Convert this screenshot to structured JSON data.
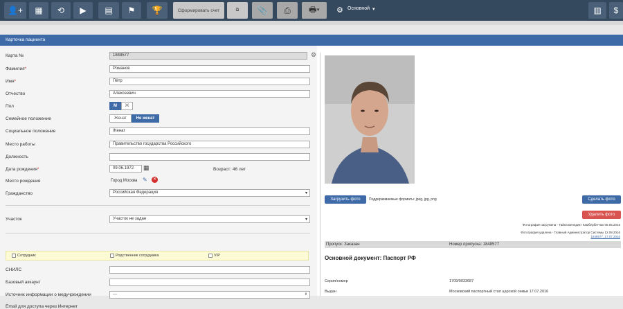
{
  "toolbar": {
    "form_invoice_label": "Сформировать счет",
    "profile_label": "Основной",
    "dollar_symbol": "$"
  },
  "panel": {
    "title": "Карточка пациента"
  },
  "form": {
    "card_label": "Карта №",
    "card_value": "1848577",
    "surname_label": "Фамилия",
    "surname_value": "Романов",
    "name_label": "Имя",
    "name_value": "Пётр",
    "patronymic_label": "Отчество",
    "patronymic_value": "Алексеевич",
    "sex_label": "Пол",
    "sex_m": "М",
    "sex_f": "Ж",
    "marital_label": "Семейное положение",
    "marital_married": "Женат",
    "marital_single": "Не женат",
    "social_label": "Социальное положение",
    "social_value": "Женат",
    "work_label": "Место работы",
    "work_value": "Правительство государства Российского",
    "position_label": "Должность",
    "position_value": "",
    "birthdate_label": "Дата рождения",
    "birthdate_value": "09.06.1972",
    "age_text": "Возраст: 46 лет",
    "birthplace_label": "Место рождения",
    "birthplace_value": "Город Москва",
    "citizenship_label": "Гражданство",
    "citizenship_value": "Российская Федерация",
    "area_label": "Участок",
    "area_value": "Участок не задан",
    "cb_employee": "Сотрудник",
    "cb_relative": "Родственник сотрудника",
    "cb_vip": "VIP",
    "snils_label": "СНИЛС",
    "base_account_label": "Базовый аккаунт",
    "source_label": "Источник информации о медучреждении",
    "source_value": "---",
    "email_label": "Email для доступа через Интернет"
  },
  "photo_panel": {
    "upload_button": "Загрузить фото",
    "formats_text": "Поддерживаемые форматы: jpeg, jpg, png",
    "take_photo_button": "Сделать фото",
    "delete_photo_button": "Удалить фото",
    "uploaded_note": "Фотография загружена - Тайна Бенедикт Камбербетчюк 05.05.2016",
    "deleted_note": "Фотография удалена - Главный Администратор Системы 12.09.2016",
    "date_link": "1848577_17.07.2016",
    "pass_label": "Пропуск: Заказан",
    "pass_number": "Номер пропуска: 1848577",
    "doc_title": "Основной документ: Паспорт РФ",
    "series_label": "Серия/номер",
    "series_value": "1709/0033687",
    "issued_label": "Выдан",
    "issued_value": "Московский паспортный стол царской семьи 17.07.2016"
  }
}
